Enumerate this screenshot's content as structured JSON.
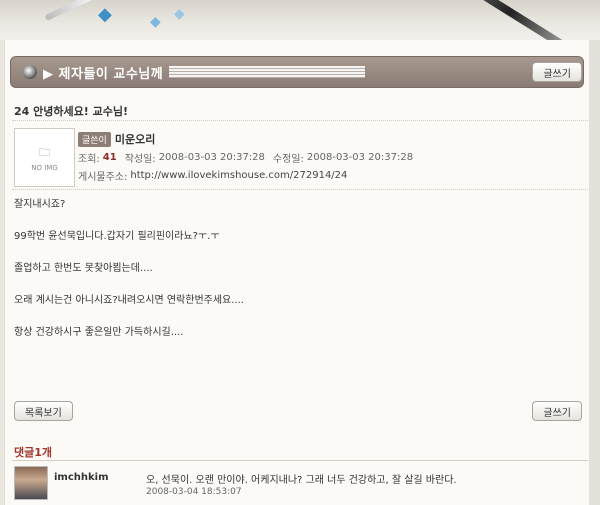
{
  "board": {
    "title": "▶ 제자들이 교수님께",
    "write_label": "글쓰기"
  },
  "post": {
    "title": "24 안녕하세요! 교수님!",
    "noimg_label": "NO IMG",
    "writer_badge": "글쓴이",
    "writer_name": "미운오리",
    "views_label": "조회:",
    "views": "41",
    "created_label": "작성일:",
    "created": "2008-03-03 20:37:28",
    "modified_label": "수정일:",
    "modified": "2008-03-03 20:37:28",
    "address_label": "게시물주소:",
    "address": "http://www.ilovekimshouse.com/272914/24",
    "body": [
      "잘지내시죠?",
      "99학번 윤선묵입니다.갑자기 필리핀이라뇨?ㅜ.ㅜ",
      "졸업하고 한번도 못찾아뵙는데....",
      "오래 계시는건 아니시죠?내려오시면  연락한번주세요....",
      "항상 건강하시구 좋은일만 가득하시길...."
    ]
  },
  "actions": {
    "list_label": "목록보기",
    "write_label": "글쓰기"
  },
  "comments": {
    "header": "댓글1개",
    "items": [
      {
        "user": "imchhkim",
        "text": "오, 선묵이. 오랜 만이야. 어케지내나? 그래 너두 건강하고, 잘 살길 바란다.",
        "date": "2008-03-04 18:53:07"
      }
    ]
  },
  "icons": {
    "disc": "disc-icon",
    "play": "play-icon",
    "folder": "folder-icon",
    "butterfly": "butterfly-icon"
  }
}
